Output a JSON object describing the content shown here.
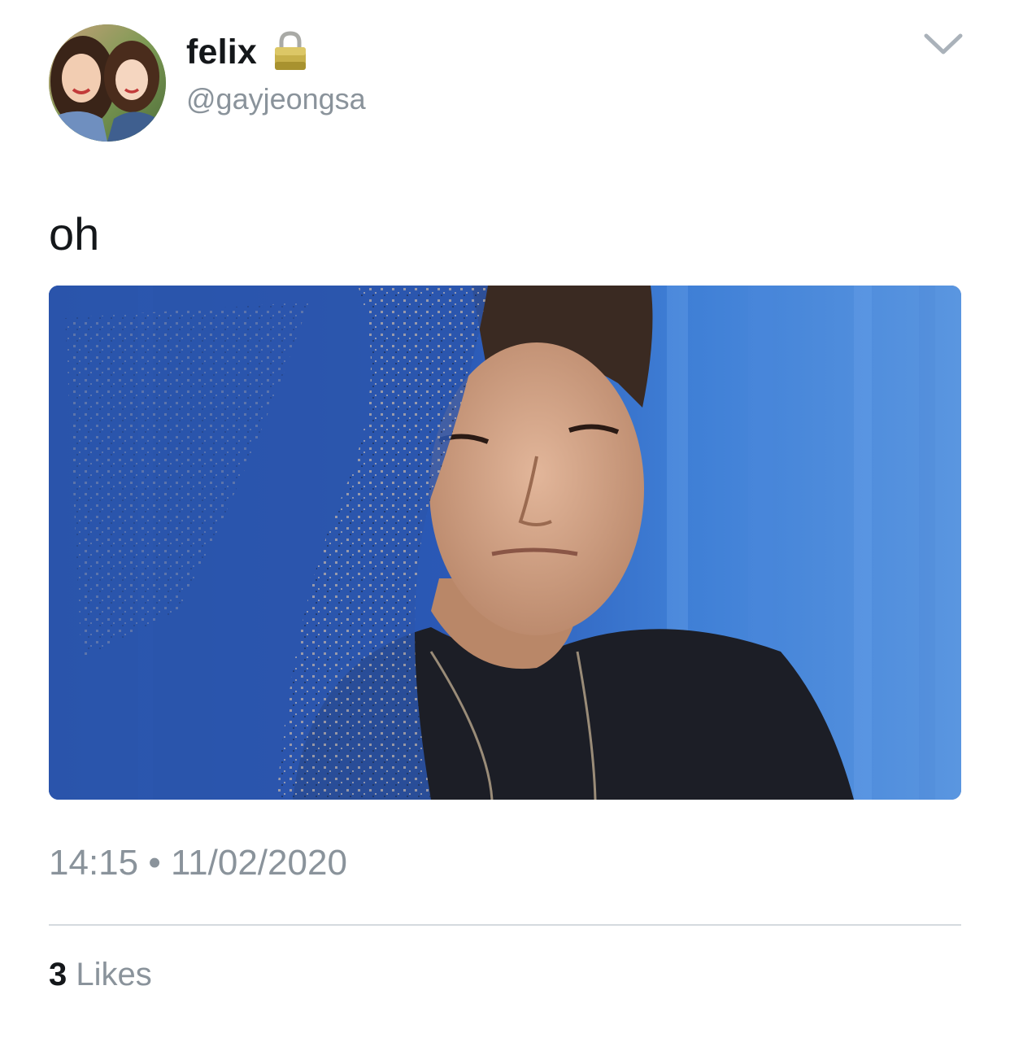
{
  "author": {
    "display_name": "felix",
    "handle": "@gayjeongsa",
    "avatar_icon": "avatar-photo",
    "protected_icon": "lock-icon"
  },
  "menu": {
    "icon": "chevron-down-icon"
  },
  "tweet": {
    "text": "oh",
    "timestamp": "14:15 • 11/02/2020",
    "media_icon": "photo"
  },
  "stats": {
    "likes_count": "3",
    "likes_label": "Likes"
  },
  "colors": {
    "text_primary": "#14171a",
    "text_secondary": "#8a939b",
    "divider": "#d5dadf",
    "media_background": "#2d5ab0"
  }
}
